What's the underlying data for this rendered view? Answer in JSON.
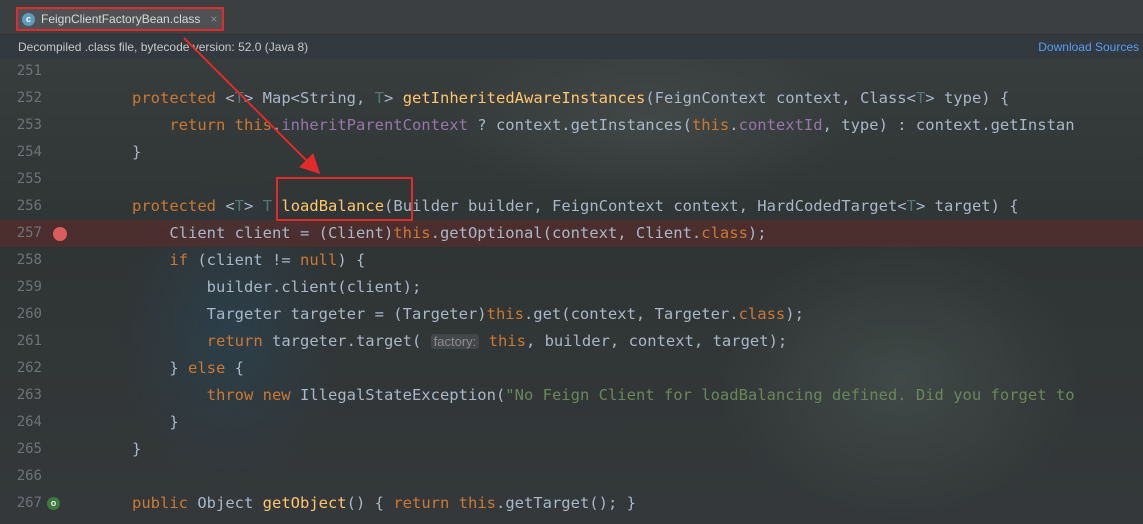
{
  "tab": {
    "label": "FeignClientFactoryBean.class",
    "close": "×",
    "icon": "class-file-icon"
  },
  "banner": {
    "text": "Decompiled .class file, bytecode version: 52.0 (Java 8)",
    "link": "Download Sources"
  },
  "lines": [
    {
      "n": "251",
      "segs": []
    },
    {
      "n": "252",
      "segs": [
        {
          "c": "kw",
          "t": "protected "
        },
        {
          "c": "",
          "t": "<"
        },
        {
          "c": "tp",
          "t": "T"
        },
        {
          "c": "",
          "t": "> Map<String, "
        },
        {
          "c": "tp",
          "t": "T"
        },
        {
          "c": "",
          "t": "> "
        },
        {
          "c": "fn",
          "t": "getInheritedAwareInstances"
        },
        {
          "c": "",
          "t": "(FeignContext context, Class<"
        },
        {
          "c": "tp",
          "t": "T"
        },
        {
          "c": "",
          "t": "> type) {"
        }
      ]
    },
    {
      "n": "253",
      "segs": [
        {
          "c": "",
          "t": "    "
        },
        {
          "c": "kw",
          "t": "return this"
        },
        {
          "c": "",
          "t": "."
        },
        {
          "c": "fld",
          "t": "inheritParentContext"
        },
        {
          "c": "",
          "t": " ? context.getInstances("
        },
        {
          "c": "kw",
          "t": "this"
        },
        {
          "c": "",
          "t": "."
        },
        {
          "c": "fld",
          "t": "contextId"
        },
        {
          "c": "",
          "t": ", type) : context.getInstan"
        }
      ]
    },
    {
      "n": "254",
      "segs": [
        {
          "c": "",
          "t": "}"
        }
      ]
    },
    {
      "n": "255",
      "segs": []
    },
    {
      "n": "256",
      "segs": [
        {
          "c": "kw",
          "t": "protected "
        },
        {
          "c": "",
          "t": "<"
        },
        {
          "c": "tp",
          "t": "T"
        },
        {
          "c": "",
          "t": "> "
        },
        {
          "c": "tp",
          "t": "T"
        },
        {
          "c": "",
          "t": " "
        },
        {
          "c": "fn",
          "t": "loadBalance"
        },
        {
          "c": "",
          "t": "(Builder builder, FeignContext context, HardCodedTarget<"
        },
        {
          "c": "tp",
          "t": "T"
        },
        {
          "c": "",
          "t": "> target) {"
        }
      ]
    },
    {
      "n": "257",
      "bp": true,
      "segs": [
        {
          "c": "",
          "t": "    Client client = (Client)"
        },
        {
          "c": "kw",
          "t": "this"
        },
        {
          "c": "",
          "t": ".getOptional(context, Client."
        },
        {
          "c": "kw",
          "t": "class"
        },
        {
          "c": "",
          "t": ");"
        }
      ]
    },
    {
      "n": "258",
      "segs": [
        {
          "c": "",
          "t": "    "
        },
        {
          "c": "kw",
          "t": "if"
        },
        {
          "c": "",
          "t": " (client != "
        },
        {
          "c": "kw",
          "t": "null"
        },
        {
          "c": "",
          "t": ") {"
        }
      ]
    },
    {
      "n": "259",
      "segs": [
        {
          "c": "",
          "t": "        builder.client(client);"
        }
      ]
    },
    {
      "n": "260",
      "segs": [
        {
          "c": "",
          "t": "        Targeter targeter = (Targeter)"
        },
        {
          "c": "kw",
          "t": "this"
        },
        {
          "c": "",
          "t": ".get(context, Targeter."
        },
        {
          "c": "kw",
          "t": "class"
        },
        {
          "c": "",
          "t": ");"
        }
      ]
    },
    {
      "n": "261",
      "segs": [
        {
          "c": "",
          "t": "        "
        },
        {
          "c": "kw",
          "t": "return"
        },
        {
          "c": "",
          "t": " targeter.target( "
        },
        {
          "c": "hint",
          "t": "factory:"
        },
        {
          "c": "",
          "t": " "
        },
        {
          "c": "kw",
          "t": "this"
        },
        {
          "c": "",
          "t": ", builder, context, target);"
        }
      ]
    },
    {
      "n": "262",
      "segs": [
        {
          "c": "",
          "t": "    } "
        },
        {
          "c": "kw",
          "t": "else"
        },
        {
          "c": "",
          "t": " {"
        }
      ]
    },
    {
      "n": "263",
      "segs": [
        {
          "c": "",
          "t": "        "
        },
        {
          "c": "kw",
          "t": "throw new"
        },
        {
          "c": "",
          "t": " IllegalStateException("
        },
        {
          "c": "str",
          "t": "\"No Feign Client for loadBalancing defined. Did you forget to"
        }
      ]
    },
    {
      "n": "264",
      "segs": [
        {
          "c": "",
          "t": "    }"
        }
      ]
    },
    {
      "n": "265",
      "segs": [
        {
          "c": "",
          "t": "}"
        }
      ]
    },
    {
      "n": "266",
      "segs": []
    },
    {
      "n": "267",
      "impl": true,
      "segs": [
        {
          "c": "kw",
          "t": "public"
        },
        {
          "c": "",
          "t": " Object "
        },
        {
          "c": "fn",
          "t": "getObject"
        },
        {
          "c": "",
          "t": "() { "
        },
        {
          "c": "kw",
          "t": "return this"
        },
        {
          "c": "",
          "t": ".getTarget(); }"
        }
      ]
    }
  ],
  "colors": {
    "keyword": "#cc7832",
    "method": "#ffc66d",
    "field": "#9876aa",
    "string": "#6a8759",
    "annotation": "#e12a2a"
  }
}
